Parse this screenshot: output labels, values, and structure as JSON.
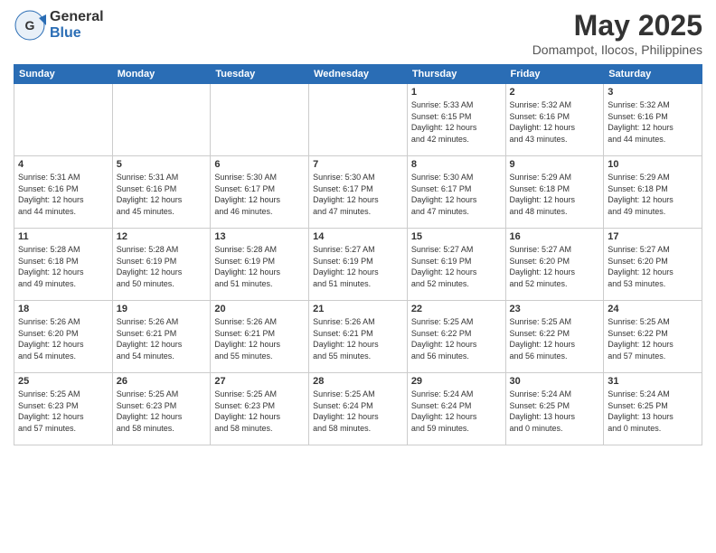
{
  "logo": {
    "general": "General",
    "blue": "Blue"
  },
  "header": {
    "title": "May 2025",
    "subtitle": "Domampot, Ilocos, Philippines"
  },
  "days_of_week": [
    "Sunday",
    "Monday",
    "Tuesday",
    "Wednesday",
    "Thursday",
    "Friday",
    "Saturday"
  ],
  "weeks": [
    [
      {
        "day": "",
        "info": ""
      },
      {
        "day": "",
        "info": ""
      },
      {
        "day": "",
        "info": ""
      },
      {
        "day": "",
        "info": ""
      },
      {
        "day": "1",
        "info": "Sunrise: 5:33 AM\nSunset: 6:15 PM\nDaylight: 12 hours\nand 42 minutes."
      },
      {
        "day": "2",
        "info": "Sunrise: 5:32 AM\nSunset: 6:16 PM\nDaylight: 12 hours\nand 43 minutes."
      },
      {
        "day": "3",
        "info": "Sunrise: 5:32 AM\nSunset: 6:16 PM\nDaylight: 12 hours\nand 44 minutes."
      }
    ],
    [
      {
        "day": "4",
        "info": "Sunrise: 5:31 AM\nSunset: 6:16 PM\nDaylight: 12 hours\nand 44 minutes."
      },
      {
        "day": "5",
        "info": "Sunrise: 5:31 AM\nSunset: 6:16 PM\nDaylight: 12 hours\nand 45 minutes."
      },
      {
        "day": "6",
        "info": "Sunrise: 5:30 AM\nSunset: 6:17 PM\nDaylight: 12 hours\nand 46 minutes."
      },
      {
        "day": "7",
        "info": "Sunrise: 5:30 AM\nSunset: 6:17 PM\nDaylight: 12 hours\nand 47 minutes."
      },
      {
        "day": "8",
        "info": "Sunrise: 5:30 AM\nSunset: 6:17 PM\nDaylight: 12 hours\nand 47 minutes."
      },
      {
        "day": "9",
        "info": "Sunrise: 5:29 AM\nSunset: 6:18 PM\nDaylight: 12 hours\nand 48 minutes."
      },
      {
        "day": "10",
        "info": "Sunrise: 5:29 AM\nSunset: 6:18 PM\nDaylight: 12 hours\nand 49 minutes."
      }
    ],
    [
      {
        "day": "11",
        "info": "Sunrise: 5:28 AM\nSunset: 6:18 PM\nDaylight: 12 hours\nand 49 minutes."
      },
      {
        "day": "12",
        "info": "Sunrise: 5:28 AM\nSunset: 6:19 PM\nDaylight: 12 hours\nand 50 minutes."
      },
      {
        "day": "13",
        "info": "Sunrise: 5:28 AM\nSunset: 6:19 PM\nDaylight: 12 hours\nand 51 minutes."
      },
      {
        "day": "14",
        "info": "Sunrise: 5:27 AM\nSunset: 6:19 PM\nDaylight: 12 hours\nand 51 minutes."
      },
      {
        "day": "15",
        "info": "Sunrise: 5:27 AM\nSunset: 6:19 PM\nDaylight: 12 hours\nand 52 minutes."
      },
      {
        "day": "16",
        "info": "Sunrise: 5:27 AM\nSunset: 6:20 PM\nDaylight: 12 hours\nand 52 minutes."
      },
      {
        "day": "17",
        "info": "Sunrise: 5:27 AM\nSunset: 6:20 PM\nDaylight: 12 hours\nand 53 minutes."
      }
    ],
    [
      {
        "day": "18",
        "info": "Sunrise: 5:26 AM\nSunset: 6:20 PM\nDaylight: 12 hours\nand 54 minutes."
      },
      {
        "day": "19",
        "info": "Sunrise: 5:26 AM\nSunset: 6:21 PM\nDaylight: 12 hours\nand 54 minutes."
      },
      {
        "day": "20",
        "info": "Sunrise: 5:26 AM\nSunset: 6:21 PM\nDaylight: 12 hours\nand 55 minutes."
      },
      {
        "day": "21",
        "info": "Sunrise: 5:26 AM\nSunset: 6:21 PM\nDaylight: 12 hours\nand 55 minutes."
      },
      {
        "day": "22",
        "info": "Sunrise: 5:25 AM\nSunset: 6:22 PM\nDaylight: 12 hours\nand 56 minutes."
      },
      {
        "day": "23",
        "info": "Sunrise: 5:25 AM\nSunset: 6:22 PM\nDaylight: 12 hours\nand 56 minutes."
      },
      {
        "day": "24",
        "info": "Sunrise: 5:25 AM\nSunset: 6:22 PM\nDaylight: 12 hours\nand 57 minutes."
      }
    ],
    [
      {
        "day": "25",
        "info": "Sunrise: 5:25 AM\nSunset: 6:23 PM\nDaylight: 12 hours\nand 57 minutes."
      },
      {
        "day": "26",
        "info": "Sunrise: 5:25 AM\nSunset: 6:23 PM\nDaylight: 12 hours\nand 58 minutes."
      },
      {
        "day": "27",
        "info": "Sunrise: 5:25 AM\nSunset: 6:23 PM\nDaylight: 12 hours\nand 58 minutes."
      },
      {
        "day": "28",
        "info": "Sunrise: 5:25 AM\nSunset: 6:24 PM\nDaylight: 12 hours\nand 58 minutes."
      },
      {
        "day": "29",
        "info": "Sunrise: 5:24 AM\nSunset: 6:24 PM\nDaylight: 12 hours\nand 59 minutes."
      },
      {
        "day": "30",
        "info": "Sunrise: 5:24 AM\nSunset: 6:25 PM\nDaylight: 13 hours\nand 0 minutes."
      },
      {
        "day": "31",
        "info": "Sunrise: 5:24 AM\nSunset: 6:25 PM\nDaylight: 13 hours\nand 0 minutes."
      }
    ]
  ]
}
